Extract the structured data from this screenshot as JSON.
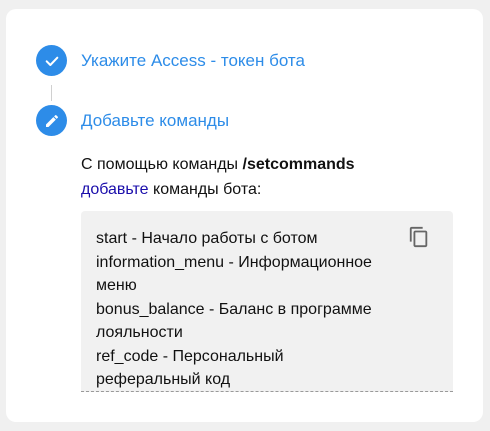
{
  "steps": [
    {
      "title": "Укажите Access - токен бота",
      "icon": "check-icon",
      "status": "done"
    },
    {
      "title": "Добавьте команды",
      "icon": "pencil-icon",
      "status": "active"
    }
  ],
  "instructions": {
    "prefix": "С помощью команды ",
    "command": "/setcommands",
    "link": "добавьте",
    "suffix": " команды бота:"
  },
  "code_block": {
    "text": "start - Начало работы с ботом\ninformation_menu - Информационное меню\nbonus_balance - Баланс в программе лояльности\nref_code - Персональный реферальный код",
    "copy_icon": "copy-icon"
  },
  "colors": {
    "accent": "#2d8ce8",
    "link": "#1a0dab",
    "code_background": "#f1f1f1"
  }
}
